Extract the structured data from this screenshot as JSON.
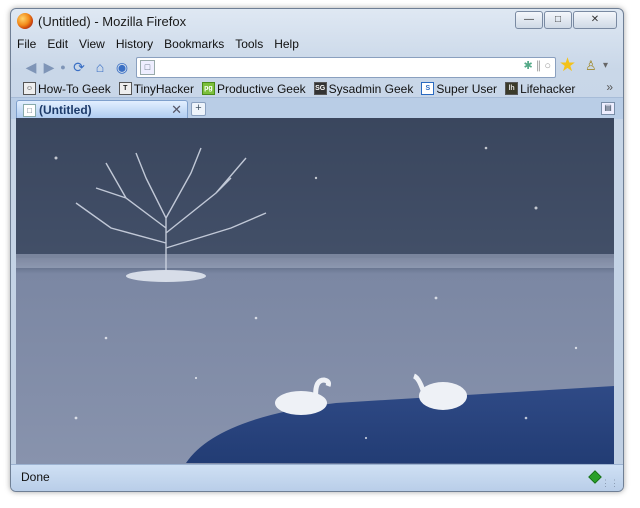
{
  "window": {
    "title": "(Untitled) - Mozilla Firefox"
  },
  "menu": [
    "File",
    "Edit",
    "View",
    "History",
    "Bookmarks",
    "Tools",
    "Help"
  ],
  "urlbar": {
    "value": ""
  },
  "bookmarks": [
    {
      "label": "How-To Geek",
      "icon": "htg-icon"
    },
    {
      "label": "TinyHacker",
      "icon": "tinyhacker-icon"
    },
    {
      "label": "Productive Geek",
      "icon": "pg-icon"
    },
    {
      "label": "Sysadmin Geek",
      "icon": "sg-icon"
    },
    {
      "label": "Super User",
      "icon": "su-icon"
    },
    {
      "label": "Lifehacker",
      "icon": "lh-icon"
    }
  ],
  "tab": {
    "title": "(Untitled)"
  },
  "status": {
    "text": "Done"
  },
  "colors": {
    "frame": "#c9d7e8",
    "tab_active": "#a9c8ef",
    "status": "#b8cde8"
  },
  "content": {
    "description_icon": "snowy-lake-swans-image"
  }
}
